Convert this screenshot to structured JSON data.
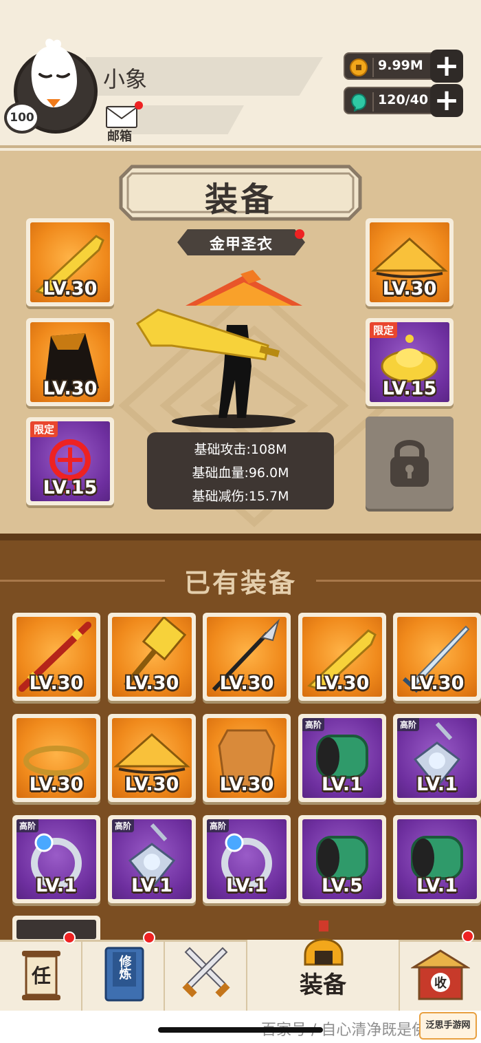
{
  "player": {
    "name": "小象",
    "level": "100",
    "mail_label": "邮箱"
  },
  "currencies": [
    {
      "icon": "coin-icon",
      "value": "9.99M",
      "color": "#f2a71b"
    },
    {
      "icon": "gem-icon",
      "value": "120/40",
      "color": "#2fc9a5"
    }
  ],
  "equip": {
    "title": "装备",
    "set_name": "金甲圣衣",
    "stats": [
      "基础攻击:108M",
      "基础血量:96.0M",
      "基础减伤:15.7M"
    ],
    "left_slots": [
      {
        "item": "golden-sword-icon",
        "level": "LV.30",
        "rarity": "orange",
        "tag": ""
      },
      {
        "item": "cloak-icon",
        "level": "LV.30",
        "rarity": "orange",
        "tag": ""
      },
      {
        "item": "chinese-knot-icon",
        "level": "LV.15",
        "rarity": "purple",
        "tag": "限定"
      }
    ],
    "right_slots": [
      {
        "item": "straw-hat-icon",
        "level": "LV.30",
        "rarity": "orange",
        "tag": ""
      },
      {
        "item": "gold-ingot-icon",
        "level": "LV.15",
        "rarity": "purple",
        "tag": "限定"
      }
    ]
  },
  "owned": {
    "title": "已有装备",
    "items": [
      {
        "item": "staff-icon",
        "level": "LV.30",
        "rarity": "orange",
        "tag": ""
      },
      {
        "item": "hammer-icon",
        "level": "LV.30",
        "rarity": "orange",
        "tag": ""
      },
      {
        "item": "spear-icon",
        "level": "LV.30",
        "rarity": "orange",
        "tag": ""
      },
      {
        "item": "golden-sword-icon",
        "level": "LV.30",
        "rarity": "orange",
        "tag": ""
      },
      {
        "item": "steel-sword-icon",
        "level": "LV.30",
        "rarity": "orange",
        "tag": ""
      },
      {
        "item": "headband-icon",
        "level": "LV.30",
        "rarity": "orange",
        "tag": ""
      },
      {
        "item": "straw-hat-icon",
        "level": "LV.30",
        "rarity": "orange",
        "tag": ""
      },
      {
        "item": "armor-vest-icon",
        "level": "LV.30",
        "rarity": "orange",
        "tag": ""
      },
      {
        "item": "bracer-icon",
        "level": "LV.1",
        "rarity": "purple",
        "tag": "高阶"
      },
      {
        "item": "gem-pendant-icon",
        "level": "LV.1",
        "rarity": "purple",
        "tag": "高阶"
      },
      {
        "item": "gem-ring-icon",
        "level": "LV.1",
        "rarity": "purple",
        "tag": "高阶"
      },
      {
        "item": "gem-pendant-icon",
        "level": "LV.1",
        "rarity": "purple",
        "tag": "高阶"
      },
      {
        "item": "gem-ring-icon",
        "level": "LV.1",
        "rarity": "purple",
        "tag": "高阶"
      },
      {
        "item": "bracer-icon",
        "level": "LV.5",
        "rarity": "purple",
        "tag": ""
      },
      {
        "item": "bracer-icon",
        "level": "LV.1",
        "rarity": "purple",
        "tag": ""
      }
    ]
  },
  "nav": {
    "tasks_glyph": "任",
    "cultivate_glyph": "修炼",
    "equip_label": "装备",
    "collect_glyph": "收"
  },
  "footer": {
    "watermark": "百家号 / 自心清净既是佛",
    "logo_text": "泛思手游网"
  }
}
